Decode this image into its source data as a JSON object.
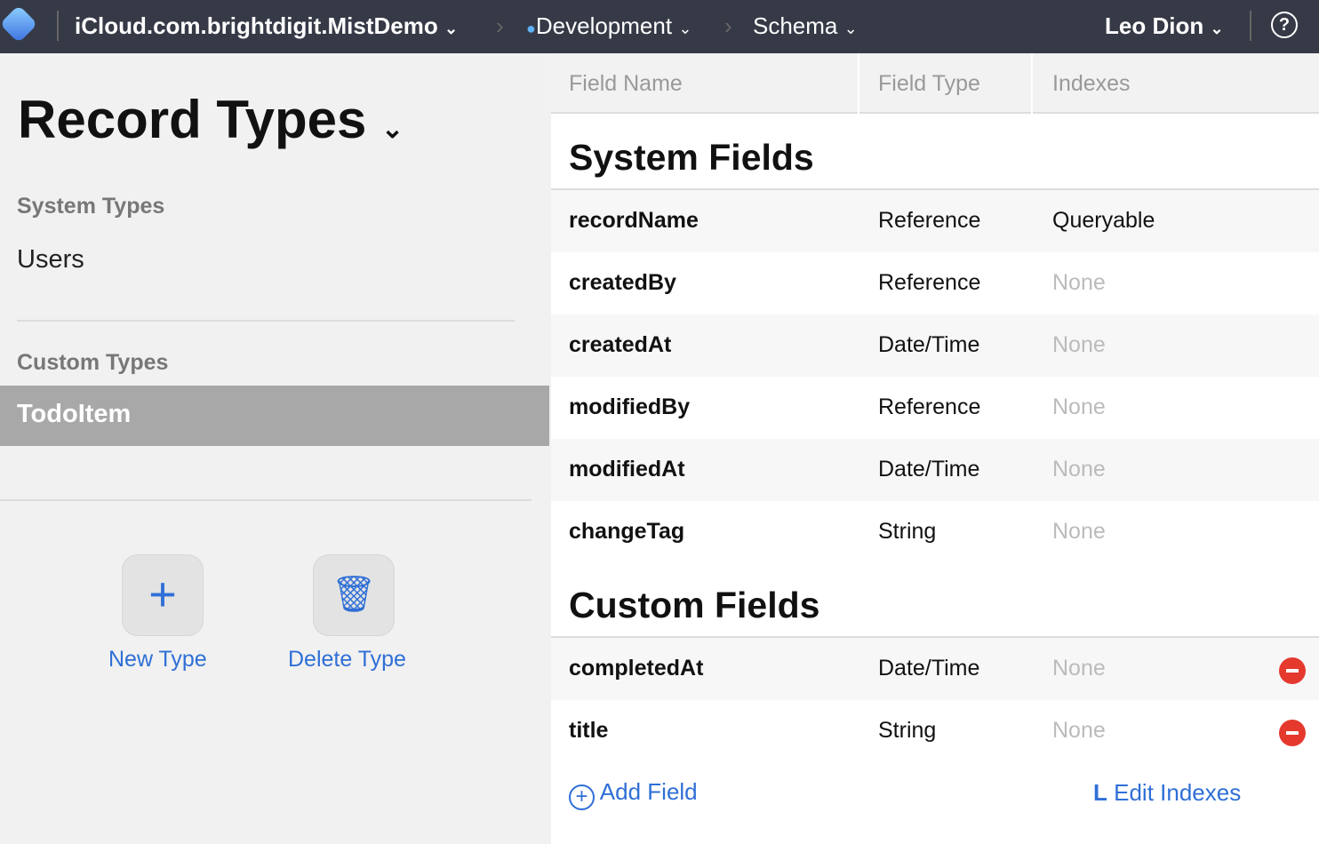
{
  "topbar": {
    "container": "iCloud.com.brightdigit.MistDemo",
    "environment": "Development",
    "section": "Schema",
    "user": "Leo Dion",
    "help": "?",
    "env_color": "#5fb0f5"
  },
  "sidebar": {
    "title": "Record Types",
    "system_header": "System Types",
    "system_items": [
      "Users"
    ],
    "custom_header": "Custom Types",
    "custom_items": [
      "TodoItem"
    ],
    "new_label": "New Type",
    "delete_label": "Delete Type"
  },
  "table": {
    "headers": [
      "Field Name",
      "Field Type",
      "Indexes"
    ],
    "system_title": "System Fields",
    "system_rows": [
      [
        "recordName",
        "Reference",
        "Queryable"
      ],
      [
        "createdBy",
        "Reference",
        "None"
      ],
      [
        "createdAt",
        "Date/Time",
        "None"
      ],
      [
        "modifiedBy",
        "Reference",
        "None"
      ],
      [
        "modifiedAt",
        "Date/Time",
        "None"
      ],
      [
        "changeTag",
        "String",
        "None"
      ]
    ],
    "custom_title": "Custom Fields",
    "custom_rows": [
      [
        "completedAt",
        "Date/Time",
        "None"
      ],
      [
        "title",
        "String",
        "None"
      ]
    ],
    "add_field": "Add Field",
    "edit_indexes": "Edit Indexes"
  }
}
